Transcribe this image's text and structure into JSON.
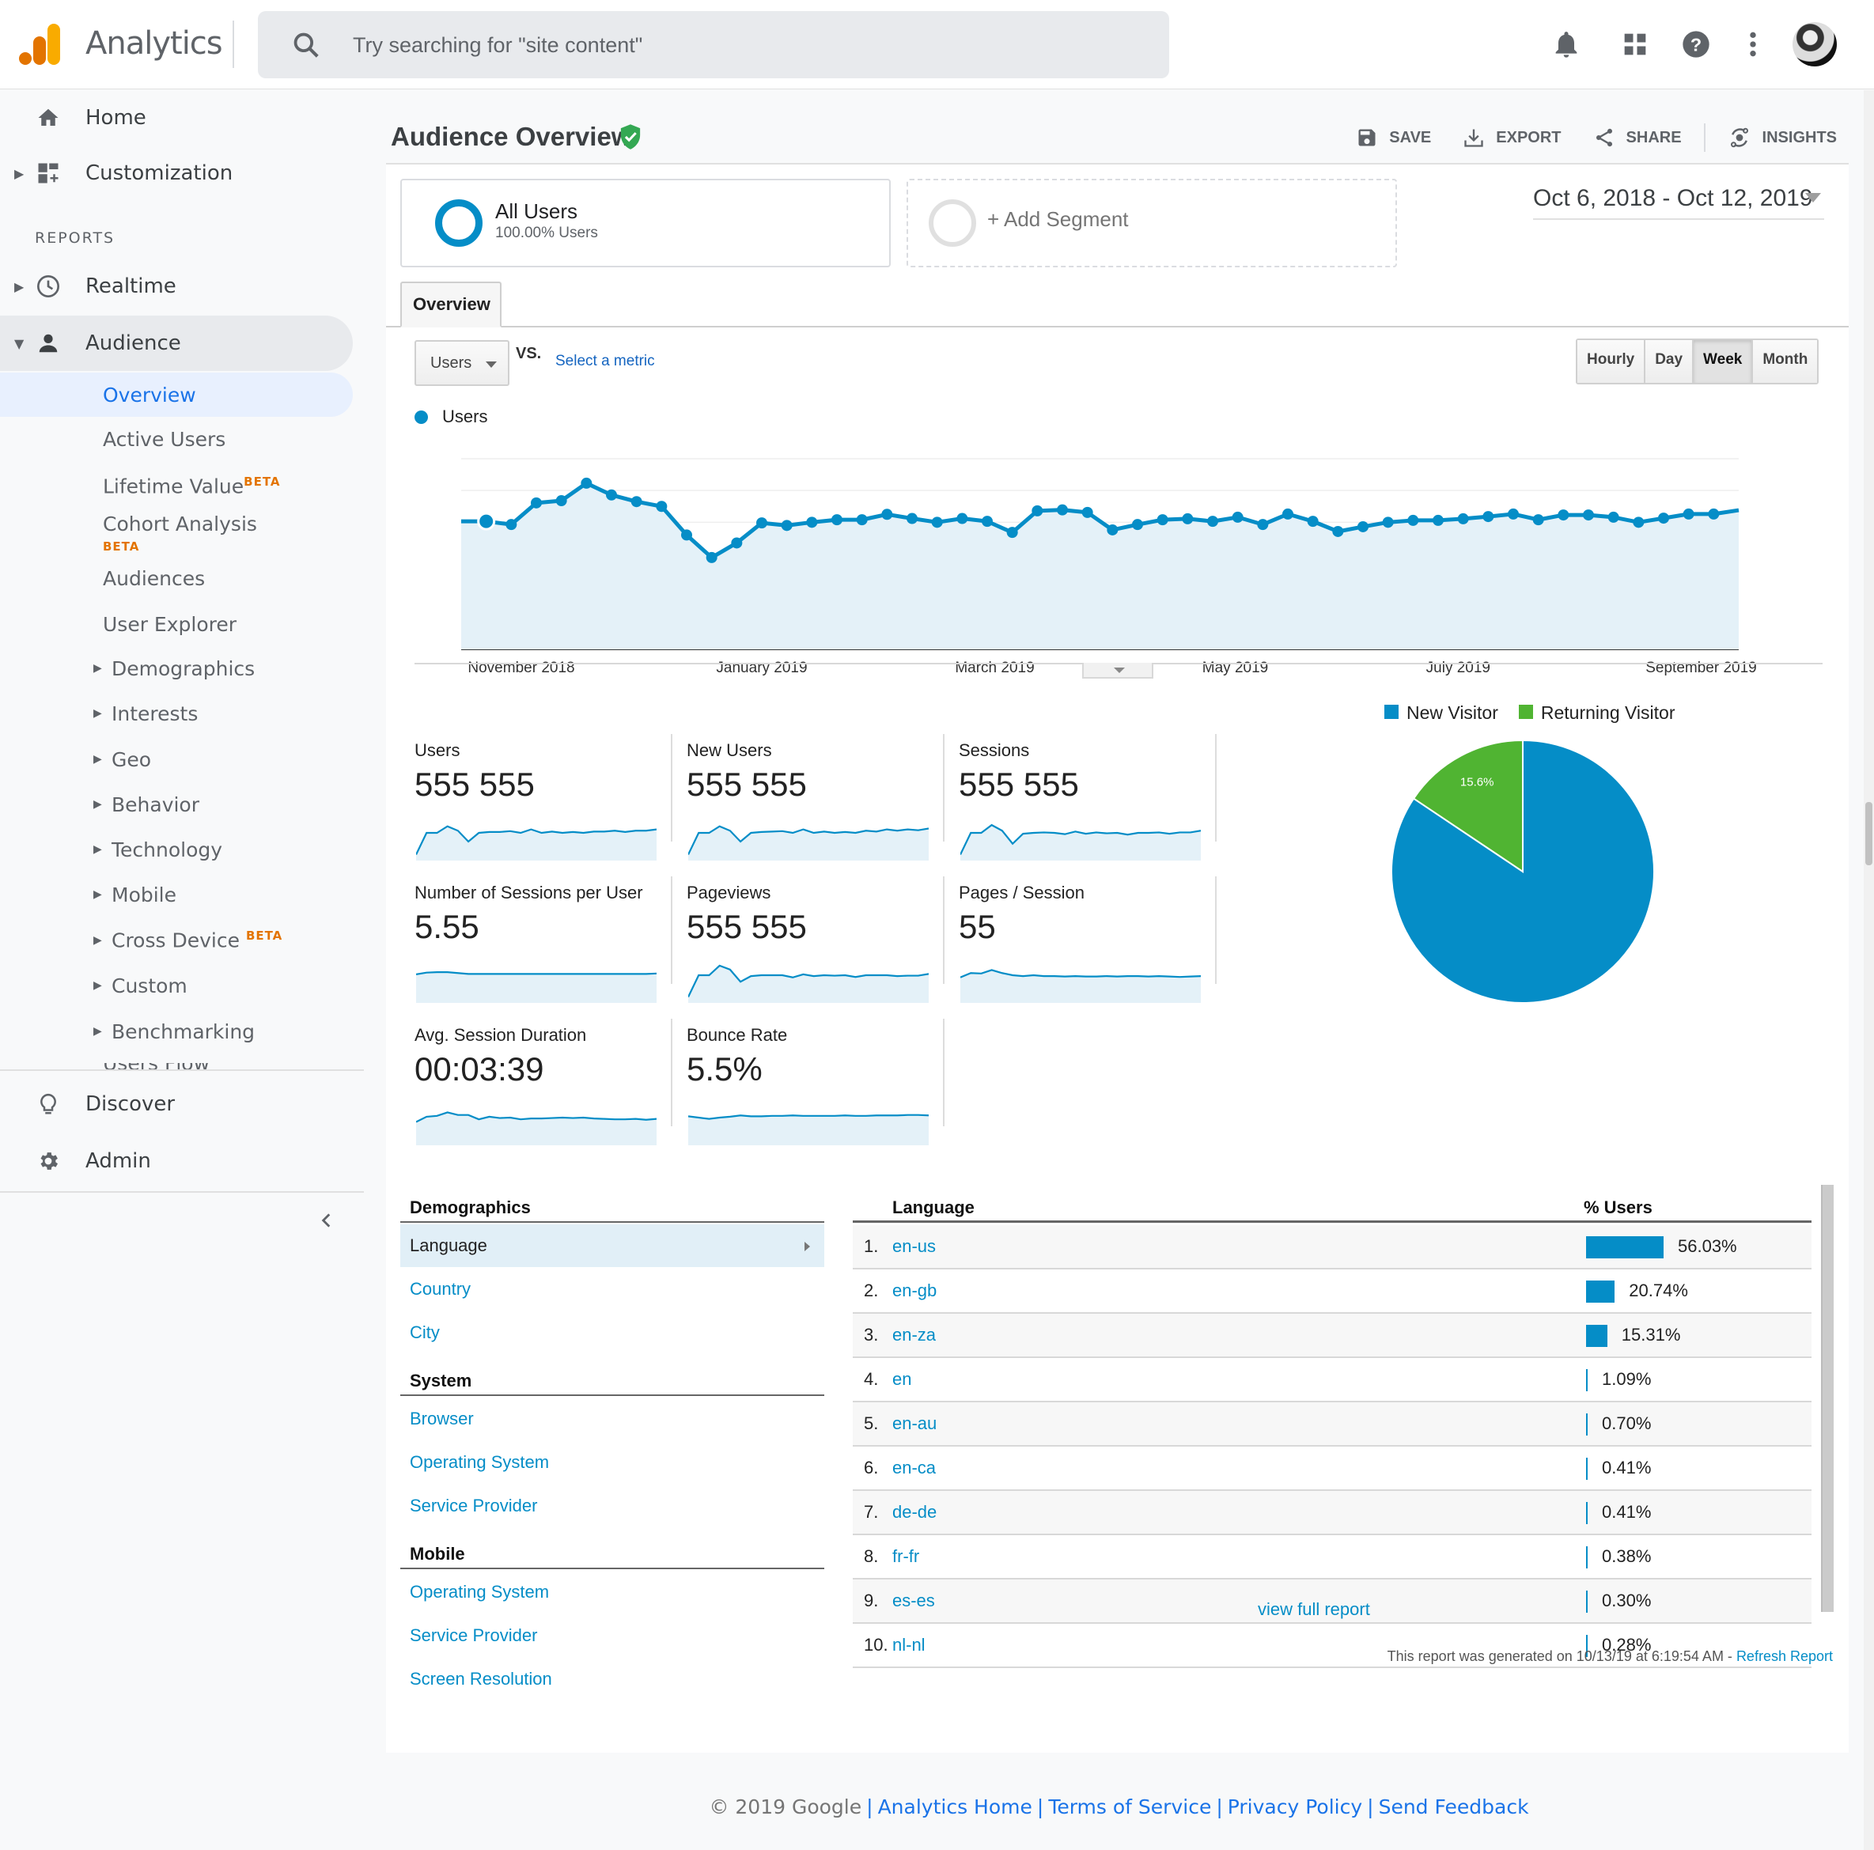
{
  "app": {
    "title": "Analytics",
    "search_placeholder": "Try searching for \"site content\"",
    "brand_colors": {
      "logo_dark": "#e37400",
      "logo_light": "#f9ab00",
      "accent": "#058dc7",
      "returning": "#50b432",
      "nav_active": "#1a73e8"
    },
    "top_icons": [
      "notifications-icon",
      "apps-grid-icon",
      "help-icon",
      "more-vert-icon",
      "account-avatar"
    ]
  },
  "sidebar": {
    "home": "Home",
    "customization": "Customization",
    "reports_label": "REPORTS",
    "realtime": "Realtime",
    "audience": "Audience",
    "audience_items": [
      {
        "label": "Overview",
        "selected": true
      },
      {
        "label": "Active Users"
      },
      {
        "label": "Lifetime Value",
        "badge": "BETA"
      },
      {
        "label": "Cohort Analysis",
        "badge": "BETA"
      },
      {
        "label": "Audiences"
      },
      {
        "label": "User Explorer"
      }
    ],
    "audience_groups": [
      {
        "label": "Demographics"
      },
      {
        "label": "Interests"
      },
      {
        "label": "Geo"
      },
      {
        "label": "Behavior"
      },
      {
        "label": "Technology"
      },
      {
        "label": "Mobile"
      },
      {
        "label": "Cross Device",
        "badge": "BETA"
      },
      {
        "label": "Custom"
      },
      {
        "label": "Benchmarking"
      }
    ],
    "cut_off_item": "Users Flow",
    "discover": "Discover",
    "admin": "Admin"
  },
  "header": {
    "page_title": "Audience Overview",
    "actions": {
      "save": "SAVE",
      "export": "EXPORT",
      "share": "SHARE",
      "insights": "INSIGHTS"
    }
  },
  "segments": {
    "all_users": {
      "name": "All Users",
      "sub": "100.00% Users"
    },
    "add_segment": "+ Add Segment"
  },
  "date_range": "Oct 6, 2018 - Oct 12, 2019",
  "tabs": {
    "overview": "Overview"
  },
  "chart_controls": {
    "metric": "Users",
    "vs": "VS.",
    "select_metric": "Select a metric",
    "granularity": [
      {
        "label": "Hourly"
      },
      {
        "label": "Day"
      },
      {
        "label": "Week",
        "active": true
      },
      {
        "label": "Month"
      }
    ]
  },
  "chart_data": [
    {
      "type": "area",
      "title": "Users",
      "legend": [
        "Users"
      ],
      "y_units": "relative (no y-axis labels shown; 6 gridline bands, top gridline = 6)",
      "ylim": [
        0,
        6
      ],
      "grid": true,
      "x_tick_labels": [
        "November 2018",
        "January 2019",
        "March 2019",
        "May 2019",
        "July 2019",
        "September 2019"
      ],
      "x_tick_positions": [
        2.4,
        12.0,
        21.3,
        30.9,
        39.8,
        49.5
      ],
      "values": [
        4.03,
        4.03,
        3.93,
        4.61,
        4.68,
        5.23,
        4.86,
        4.65,
        4.5,
        3.6,
        2.89,
        3.35,
        3.98,
        3.9,
        4.0,
        4.08,
        4.08,
        4.25,
        4.12,
        4.0,
        4.12,
        4.03,
        3.68,
        4.36,
        4.39,
        4.31,
        3.76,
        3.93,
        4.08,
        4.11,
        4.03,
        4.16,
        3.93,
        4.26,
        4.03,
        3.71,
        3.86,
        4.0,
        4.06,
        4.06,
        4.11,
        4.18,
        4.26,
        4.08,
        4.23,
        4.23,
        4.16,
        4.0,
        4.13,
        4.26,
        4.26,
        4.38
      ],
      "highlighted_index": 1
    },
    {
      "type": "pie",
      "legend": [
        "New Visitor",
        "Returning Visitor"
      ],
      "legend_position": "top",
      "categories": [
        "New Visitor",
        "Returning Visitor"
      ],
      "values": [
        84.4,
        15.6
      ],
      "labels": [
        "84.4%",
        "15.6%"
      ],
      "colors": [
        "#058dc7",
        "#50b432"
      ]
    }
  ],
  "metrics": [
    {
      "label": "Users",
      "value": "555 555",
      "spark": [
        1,
        6,
        6,
        7.5,
        6.5,
        4,
        6,
        6.2,
        6.2,
        6.4,
        6,
        6.8,
        6,
        6.3,
        6,
        6.2,
        6,
        6.3,
        6.3,
        6.5,
        6.2,
        6.5,
        6.5,
        6.8
      ]
    },
    {
      "label": "New Users",
      "value": "555 555",
      "spark": [
        1,
        6,
        6,
        7.5,
        6.5,
        4,
        6,
        6.2,
        6.3,
        6.4,
        6,
        6.8,
        6,
        6.3,
        6,
        6.2,
        6,
        6.5,
        6.3,
        6.8,
        6.5,
        6.8,
        6.6,
        7
      ]
    },
    {
      "label": "Sessions",
      "value": "555 555",
      "spark": [
        1,
        6,
        6,
        7.8,
        6.5,
        3.5,
        5.8,
        6,
        6.1,
        6,
        5.7,
        6.3,
        5.8,
        6.1,
        5.9,
        6,
        5.6,
        6,
        6,
        6.1,
        5.8,
        6.1,
        6.1,
        6.5
      ]
    },
    {
      "label": "Number of Sessions per User",
      "value": "5.55",
      "spark": [
        6.2,
        6.6,
        6.7,
        6.7,
        6.5,
        6.3,
        6.3,
        6.3,
        6.3,
        6.3,
        6.3,
        6.3,
        6.3,
        6.3,
        6.3,
        6.3,
        6.3,
        6.3,
        6.3,
        6.3,
        6.3,
        6.3,
        6.3,
        6.4
      ]
    },
    {
      "label": "Pageviews",
      "value": "555 555",
      "spark": [
        1,
        6,
        6,
        8.2,
        7.3,
        4.5,
        5.8,
        6,
        6,
        6,
        5.5,
        6.2,
        5.8,
        6,
        5.9,
        6,
        5.6,
        6,
        6,
        6,
        5.8,
        5.9,
        5.9,
        6.3
      ]
    },
    {
      "label": "Pages / Session",
      "value": "55",
      "spark": [
        5.5,
        6.5,
        6.4,
        7.2,
        6.5,
        6,
        5.8,
        6,
        5.8,
        5.8,
        5.7,
        5.8,
        5.7,
        5.7,
        5.8,
        5.7,
        5.8,
        5.8,
        5.7,
        5.8,
        5.7,
        5.6,
        5.7,
        5.8
      ]
    },
    {
      "label": "Avg. Session Duration",
      "value": "00:03:39",
      "spark": [
        5,
        6.2,
        6.4,
        7.2,
        6.6,
        6.6,
        5.6,
        6.2,
        5.9,
        6,
        5.6,
        5.8,
        5.8,
        5.9,
        6,
        5.9,
        6,
        5.8,
        5.7,
        5.6,
        5.6,
        5.7,
        5.5,
        5.7
      ]
    },
    {
      "label": "Bounce Rate",
      "value": "5.5%",
      "spark": [
        6.3,
        6,
        5.7,
        6,
        6.2,
        6.5,
        6.3,
        6.3,
        6.4,
        6.4,
        6.5,
        6.4,
        6.4,
        6.4,
        6.4,
        6.5,
        6.4,
        6.4,
        6.5,
        6.5,
        6.5,
        6.6,
        6.6,
        6.5
      ]
    }
  ],
  "demographics_nav": {
    "sections": [
      {
        "heading": "Demographics",
        "links": [
          {
            "label": "Language",
            "selected": true
          },
          {
            "label": "Country"
          },
          {
            "label": "City"
          }
        ]
      },
      {
        "heading": "System",
        "links": [
          {
            "label": "Browser"
          },
          {
            "label": "Operating System"
          },
          {
            "label": "Service Provider"
          }
        ]
      },
      {
        "heading": "Mobile",
        "links": [
          {
            "label": "Operating System"
          },
          {
            "label": "Service Provider"
          },
          {
            "label": "Screen Resolution"
          }
        ]
      }
    ]
  },
  "language_table": {
    "col_language": "Language",
    "col_users": "% Users",
    "rows": [
      {
        "rank": "1.",
        "lang": "en-us",
        "pct": "56.03%",
        "value": 56.03
      },
      {
        "rank": "2.",
        "lang": "en-gb",
        "pct": "20.74%",
        "value": 20.74
      },
      {
        "rank": "3.",
        "lang": "en-za",
        "pct": "15.31%",
        "value": 15.31
      },
      {
        "rank": "4.",
        "lang": "en",
        "pct": "1.09%",
        "value": 1.09
      },
      {
        "rank": "5.",
        "lang": "en-au",
        "pct": "0.70%",
        "value": 0.7
      },
      {
        "rank": "6.",
        "lang": "en-ca",
        "pct": "0.41%",
        "value": 0.41
      },
      {
        "rank": "7.",
        "lang": "de-de",
        "pct": "0.41%",
        "value": 0.41
      },
      {
        "rank": "8.",
        "lang": "fr-fr",
        "pct": "0.38%",
        "value": 0.38
      },
      {
        "rank": "9.",
        "lang": "es-es",
        "pct": "0.30%",
        "value": 0.3
      },
      {
        "rank": "10.",
        "lang": "nl-nl",
        "pct": "0.28%",
        "value": 0.28
      }
    ],
    "view_full_report": "view full report"
  },
  "report_generated": {
    "text": "This report was generated on 10/13/19 at 6:19:54 AM - ",
    "refresh": "Refresh Report"
  },
  "footer": {
    "copyright": "© 2019 Google",
    "links": [
      "Analytics Home",
      "Terms of Service",
      "Privacy Policy",
      "Send Feedback"
    ]
  }
}
